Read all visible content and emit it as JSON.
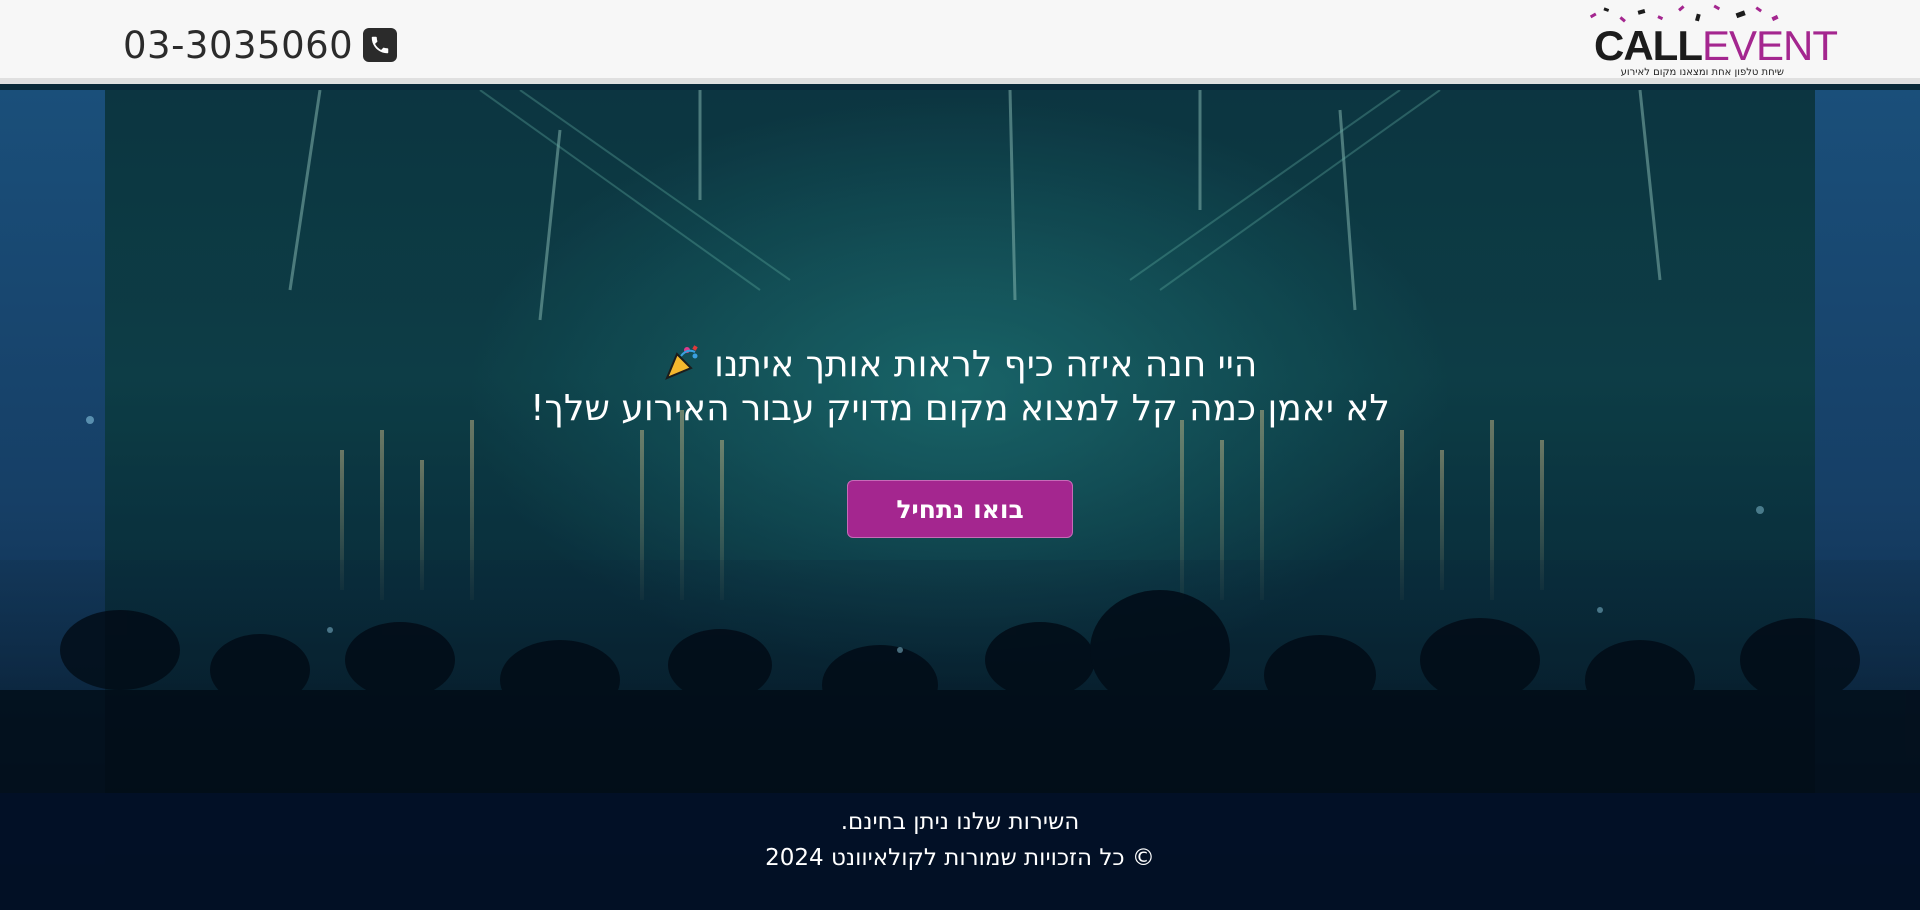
{
  "header": {
    "phone_number": "03-3035060",
    "phone_icon": "phone-icon",
    "logo": {
      "word_call": "CALL",
      "word_event": "EVENT",
      "tagline": "שיחת טלפון אחת ומצאנו מקום לאירוע",
      "color_call": "#1c1c1c",
      "color_event": "#a4268f"
    }
  },
  "hero": {
    "line1": "היי חנה איזה כיף לראות אותך איתנו",
    "line1_icon": "party-popper-icon",
    "line2": "לא יאמן כמה קל למצוא מקום מדויק עבור האירוע שלך!",
    "cta_label": "בואו נתחיל",
    "accent_color": "#a4268f"
  },
  "footer": {
    "line1": "השירות שלנו ניתן בחינם.",
    "line2": "© כל הזכויות שמורות לקולאיוונט 2024"
  }
}
